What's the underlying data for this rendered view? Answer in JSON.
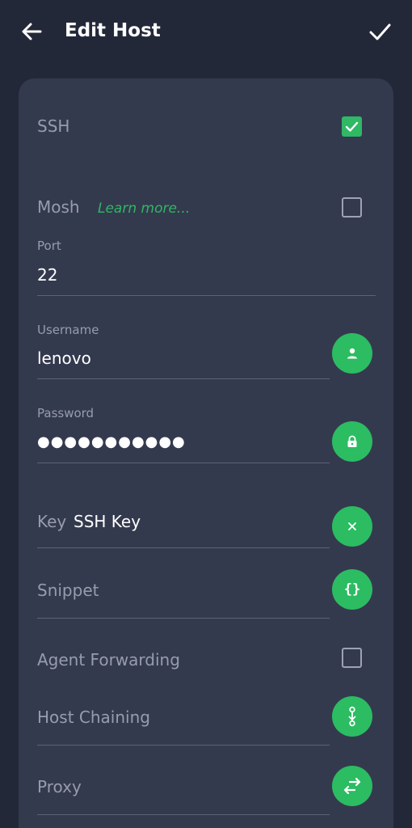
{
  "header": {
    "title": "Edit Host",
    "back_icon": "arrow-left-icon",
    "confirm_icon": "checkmark-icon"
  },
  "ssh": {
    "label": "SSH",
    "checked": true
  },
  "mosh": {
    "label": "Mosh",
    "learn_more": "Learn more...",
    "checked": false
  },
  "port": {
    "label": "Port",
    "value": "22"
  },
  "username": {
    "label": "Username",
    "value": "lenovo",
    "icon": "person-icon"
  },
  "password": {
    "label": "Password",
    "value": "●●●●●●●●●●●",
    "icon": "lock-icon"
  },
  "key": {
    "label": "Key",
    "value": "SSH Key",
    "icon": "close-icon"
  },
  "snippet": {
    "label": "Snippet",
    "icon": "braces-icon",
    "icon_text": "{}"
  },
  "agent_forwarding": {
    "label": "Agent Forwarding",
    "checked": false
  },
  "host_chaining": {
    "label": "Host Chaining",
    "icon": "chain-icon"
  },
  "proxy": {
    "label": "Proxy",
    "icon": "swap-arrows-icon"
  },
  "colors": {
    "background": "#232839",
    "card": "#343a4e",
    "accent": "#2cbc62",
    "label": "#979cad"
  }
}
